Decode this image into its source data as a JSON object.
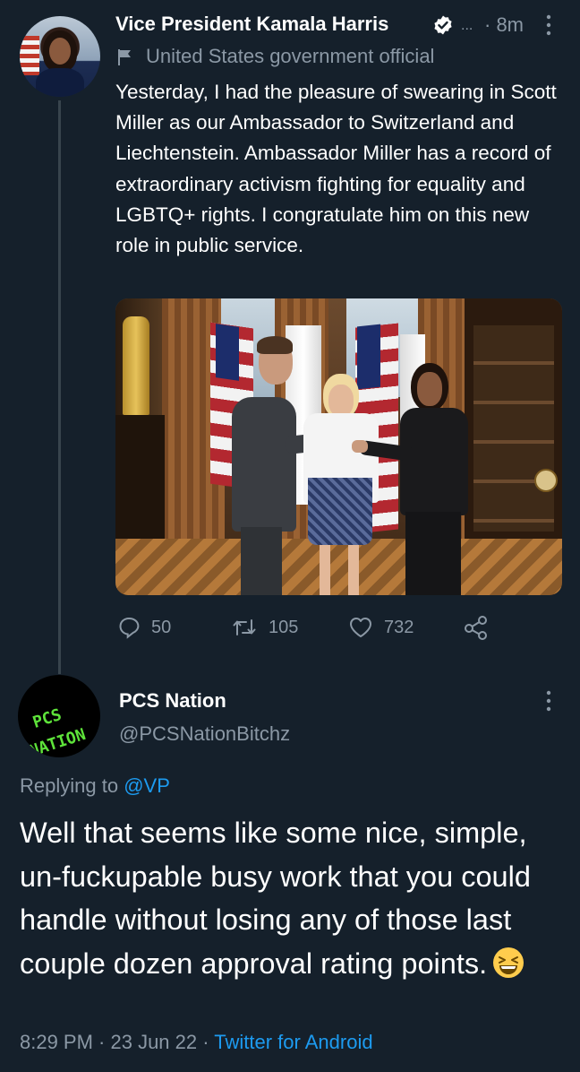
{
  "tweet": {
    "author_name": "Vice President Kamala Harris",
    "ellipsis": "...",
    "time": "· 8m",
    "gov_label": "United States government official",
    "text": "Yesterday, I had the pleasure of swearing in Scott Miller as our Ambassador to Switzerland and Liechtenstein. Ambassador Miller has a record of extraordinary activism fighting for equality and LGBTQ+ rights. I congratulate him on this new role in public service.",
    "reply_count": "50",
    "retweet_count": "105",
    "like_count": "732"
  },
  "reply": {
    "author_name": "PCS Nation",
    "handle": "@PCSNationBitchz",
    "replying_prefix": "Replying to",
    "replying_handle": "@VP",
    "text": "Well that seems like some nice, simple, un-fuckupable busy work that you could handle without losing any of those last couple dozen approval rating points.",
    "timestamp": "8:29 PM · 23 Jun 22 ·",
    "source": "Twitter for Android",
    "avatar_text_line1": "PCS",
    "avatar_text_line2": "NATION"
  },
  "colors": {
    "background": "#15202b",
    "secondary_text": "#8b98a5",
    "link": "#1d9bf0",
    "verified": "#ffffff"
  }
}
